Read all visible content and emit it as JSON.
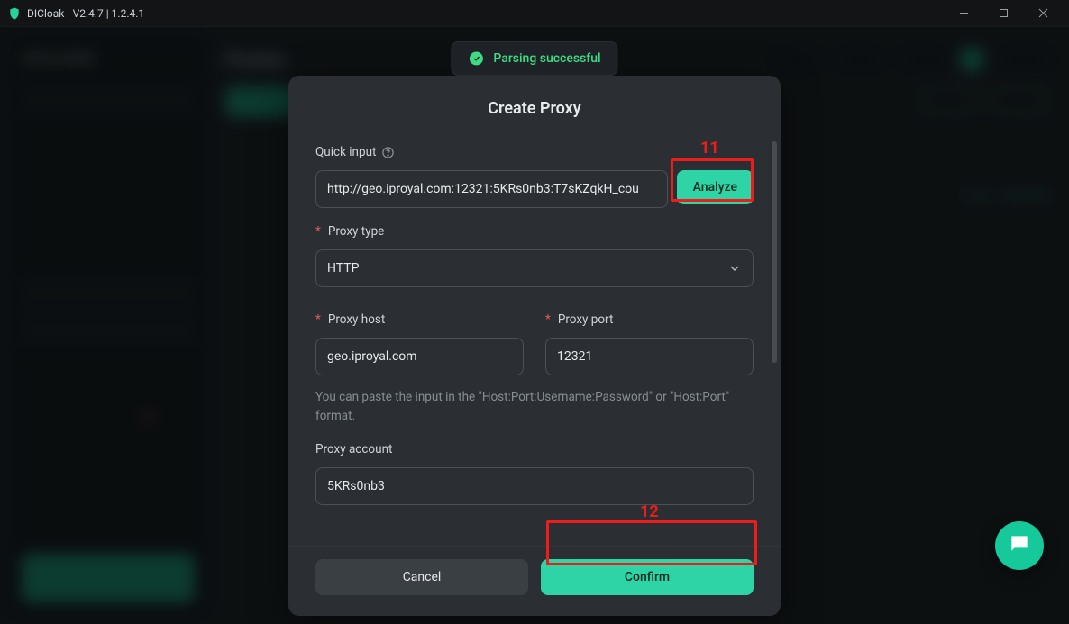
{
  "titlebar": {
    "title": "DICloak - V2.4.7 | 1.2.4.1"
  },
  "toast": {
    "text": "Parsing successful"
  },
  "modal": {
    "title": "Create Proxy",
    "quick_input_label": "Quick input",
    "quick_input_value": "http://geo.iproyal.com:12321:5KRs0nb3:T7sKZqkH_cou",
    "analyze_label": "Analyze",
    "proxy_type_label": "Proxy type",
    "proxy_type_value": "HTTP",
    "proxy_host_label": "Proxy host",
    "proxy_host_value": "geo.iproyal.com",
    "proxy_port_label": "Proxy port",
    "proxy_port_value": "12321",
    "hint": "You can paste the input in the \"Host:Port:Username:Password\" or \"Host:Port\" format.",
    "proxy_account_label": "Proxy account",
    "proxy_account_value": "5KRs0nb3",
    "cancel_label": "Cancel",
    "confirm_label": "Confirm"
  },
  "annotations": {
    "analyze": "11",
    "confirm": "12"
  },
  "background": {
    "brand": "DICLOAK",
    "section_title": "Proxies",
    "row_actions": {
      "a": "Copy",
      "b": "Operation"
    }
  }
}
